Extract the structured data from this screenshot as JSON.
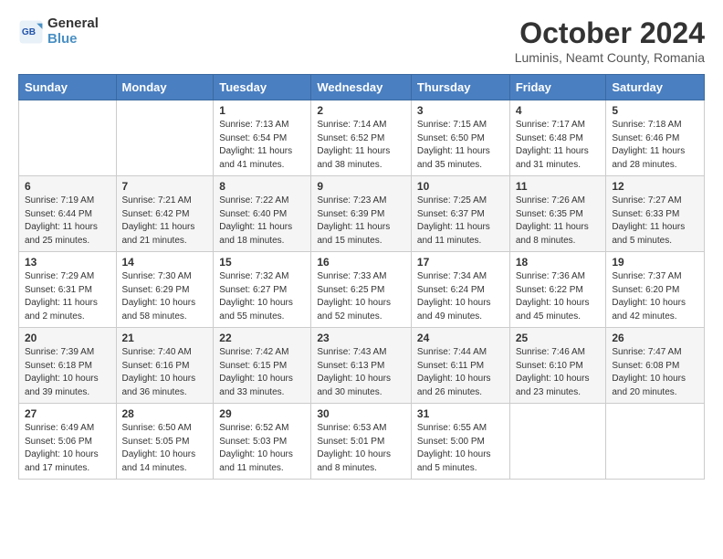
{
  "logo": {
    "line1": "General",
    "line2": "Blue"
  },
  "title": "October 2024",
  "subtitle": "Luminis, Neamt County, Romania",
  "days_of_week": [
    "Sunday",
    "Monday",
    "Tuesday",
    "Wednesday",
    "Thursday",
    "Friday",
    "Saturday"
  ],
  "weeks": [
    [
      {
        "day": "",
        "info": ""
      },
      {
        "day": "",
        "info": ""
      },
      {
        "day": "1",
        "info": "Sunrise: 7:13 AM\nSunset: 6:54 PM\nDaylight: 11 hours and 41 minutes."
      },
      {
        "day": "2",
        "info": "Sunrise: 7:14 AM\nSunset: 6:52 PM\nDaylight: 11 hours and 38 minutes."
      },
      {
        "day": "3",
        "info": "Sunrise: 7:15 AM\nSunset: 6:50 PM\nDaylight: 11 hours and 35 minutes."
      },
      {
        "day": "4",
        "info": "Sunrise: 7:17 AM\nSunset: 6:48 PM\nDaylight: 11 hours and 31 minutes."
      },
      {
        "day": "5",
        "info": "Sunrise: 7:18 AM\nSunset: 6:46 PM\nDaylight: 11 hours and 28 minutes."
      }
    ],
    [
      {
        "day": "6",
        "info": "Sunrise: 7:19 AM\nSunset: 6:44 PM\nDaylight: 11 hours and 25 minutes."
      },
      {
        "day": "7",
        "info": "Sunrise: 7:21 AM\nSunset: 6:42 PM\nDaylight: 11 hours and 21 minutes."
      },
      {
        "day": "8",
        "info": "Sunrise: 7:22 AM\nSunset: 6:40 PM\nDaylight: 11 hours and 18 minutes."
      },
      {
        "day": "9",
        "info": "Sunrise: 7:23 AM\nSunset: 6:39 PM\nDaylight: 11 hours and 15 minutes."
      },
      {
        "day": "10",
        "info": "Sunrise: 7:25 AM\nSunset: 6:37 PM\nDaylight: 11 hours and 11 minutes."
      },
      {
        "day": "11",
        "info": "Sunrise: 7:26 AM\nSunset: 6:35 PM\nDaylight: 11 hours and 8 minutes."
      },
      {
        "day": "12",
        "info": "Sunrise: 7:27 AM\nSunset: 6:33 PM\nDaylight: 11 hours and 5 minutes."
      }
    ],
    [
      {
        "day": "13",
        "info": "Sunrise: 7:29 AM\nSunset: 6:31 PM\nDaylight: 11 hours and 2 minutes."
      },
      {
        "day": "14",
        "info": "Sunrise: 7:30 AM\nSunset: 6:29 PM\nDaylight: 10 hours and 58 minutes."
      },
      {
        "day": "15",
        "info": "Sunrise: 7:32 AM\nSunset: 6:27 PM\nDaylight: 10 hours and 55 minutes."
      },
      {
        "day": "16",
        "info": "Sunrise: 7:33 AM\nSunset: 6:25 PM\nDaylight: 10 hours and 52 minutes."
      },
      {
        "day": "17",
        "info": "Sunrise: 7:34 AM\nSunset: 6:24 PM\nDaylight: 10 hours and 49 minutes."
      },
      {
        "day": "18",
        "info": "Sunrise: 7:36 AM\nSunset: 6:22 PM\nDaylight: 10 hours and 45 minutes."
      },
      {
        "day": "19",
        "info": "Sunrise: 7:37 AM\nSunset: 6:20 PM\nDaylight: 10 hours and 42 minutes."
      }
    ],
    [
      {
        "day": "20",
        "info": "Sunrise: 7:39 AM\nSunset: 6:18 PM\nDaylight: 10 hours and 39 minutes."
      },
      {
        "day": "21",
        "info": "Sunrise: 7:40 AM\nSunset: 6:16 PM\nDaylight: 10 hours and 36 minutes."
      },
      {
        "day": "22",
        "info": "Sunrise: 7:42 AM\nSunset: 6:15 PM\nDaylight: 10 hours and 33 minutes."
      },
      {
        "day": "23",
        "info": "Sunrise: 7:43 AM\nSunset: 6:13 PM\nDaylight: 10 hours and 30 minutes."
      },
      {
        "day": "24",
        "info": "Sunrise: 7:44 AM\nSunset: 6:11 PM\nDaylight: 10 hours and 26 minutes."
      },
      {
        "day": "25",
        "info": "Sunrise: 7:46 AM\nSunset: 6:10 PM\nDaylight: 10 hours and 23 minutes."
      },
      {
        "day": "26",
        "info": "Sunrise: 7:47 AM\nSunset: 6:08 PM\nDaylight: 10 hours and 20 minutes."
      }
    ],
    [
      {
        "day": "27",
        "info": "Sunrise: 6:49 AM\nSunset: 5:06 PM\nDaylight: 10 hours and 17 minutes."
      },
      {
        "day": "28",
        "info": "Sunrise: 6:50 AM\nSunset: 5:05 PM\nDaylight: 10 hours and 14 minutes."
      },
      {
        "day": "29",
        "info": "Sunrise: 6:52 AM\nSunset: 5:03 PM\nDaylight: 10 hours and 11 minutes."
      },
      {
        "day": "30",
        "info": "Sunrise: 6:53 AM\nSunset: 5:01 PM\nDaylight: 10 hours and 8 minutes."
      },
      {
        "day": "31",
        "info": "Sunrise: 6:55 AM\nSunset: 5:00 PM\nDaylight: 10 hours and 5 minutes."
      },
      {
        "day": "",
        "info": ""
      },
      {
        "day": "",
        "info": ""
      }
    ]
  ]
}
